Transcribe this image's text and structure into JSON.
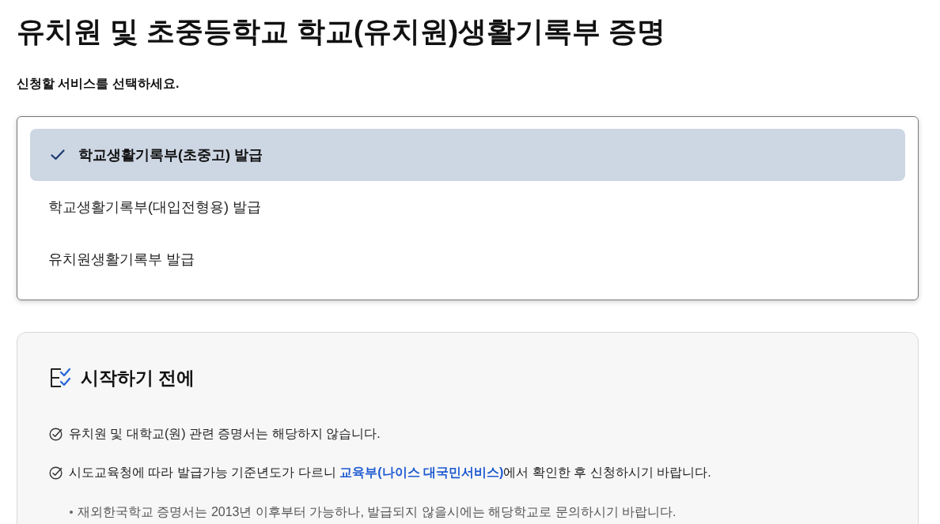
{
  "page": {
    "title": "유치원 및 초중등학교 학교(유치원)생활기록부 증명",
    "subtitle": "신청할 서비스를 선택하세요."
  },
  "service_options": [
    {
      "label": "학교생활기록부(초중고) 발급",
      "selected": true
    },
    {
      "label": "학교생활기록부(대입전형용) 발급",
      "selected": false
    },
    {
      "label": "유치원생활기록부 발급",
      "selected": false
    }
  ],
  "notice": {
    "title": "시작하기 전에",
    "items": [
      {
        "text": "유치원 및 대학교(원) 관련 증명서는 해당하지 않습니다."
      },
      {
        "text": "시도교육청에 따라 발급가능 기준년도가 다르니",
        "link": "교육부(나이스 대국민서비스)",
        "text_after": "에서 확인한 후 신청하시기 바랍니다.",
        "children": [
          {
            "text": "재외한국학교 증명서는 2013년 이후부터 가능하나, 발급되지 않을시에는 해당학교로 문의하시기 바랍니다."
          }
        ]
      }
    ]
  }
}
